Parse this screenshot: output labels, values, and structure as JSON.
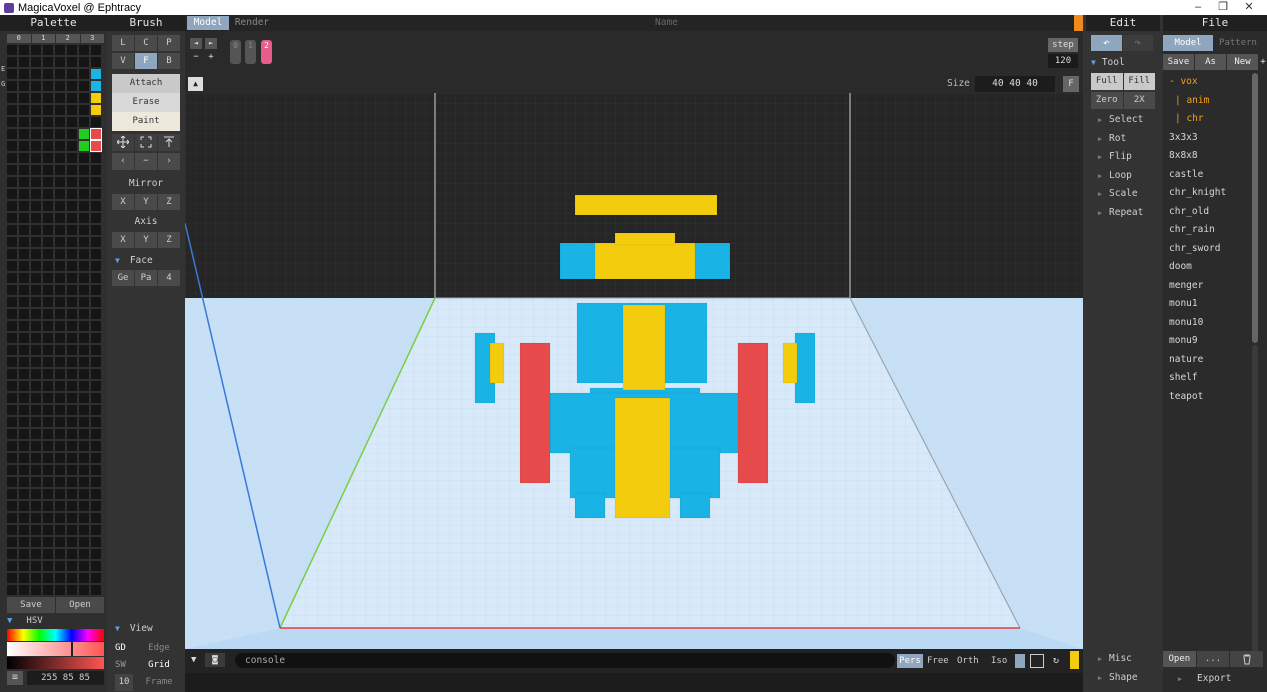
{
  "window": {
    "title": "MagicaVoxel @ Ephtracy",
    "minimize": "–",
    "restore": "❐",
    "close": "✕"
  },
  "palette": {
    "title": "Palette",
    "tabs": [
      "0",
      "1",
      "2",
      "3"
    ],
    "side_letters": [
      "E",
      "G"
    ],
    "save": "Save",
    "open": "Open",
    "hsv_label": "HSV",
    "rgb_value": "255 85 85",
    "menu_glyph": "≡",
    "swatches": {
      "cyan": "#1ab3e6",
      "yellow": "#f2cc0d",
      "green": "#22cc22",
      "red": "#e64a4a"
    }
  },
  "brush": {
    "title": "Brush",
    "row1": [
      "L",
      "C",
      "P"
    ],
    "row2": [
      "V",
      "F",
      "B"
    ],
    "modes": [
      "Attach",
      "Erase",
      "Paint"
    ],
    "nav": [
      "‹",
      "−",
      "›"
    ],
    "mirror": "Mirror",
    "mirror_axes": [
      "X",
      "Y",
      "Z"
    ],
    "axis": "Axis",
    "axis_axes": [
      "X",
      "Y",
      "Z"
    ],
    "face": "Face",
    "face_btns": [
      "Ge",
      "Pa",
      "4"
    ],
    "view": "View",
    "view_rows": [
      [
        "GD",
        "Edge"
      ],
      [
        "SW",
        "Grid"
      ],
      [
        "10",
        "Frame"
      ]
    ]
  },
  "top": {
    "tabs": [
      "Model",
      "Render"
    ],
    "name": "Name",
    "step": "step",
    "step_value": "120",
    "size_label": "Size",
    "size_value": "40 40 40",
    "f": "F",
    "frames": [
      "0",
      "1",
      "2"
    ],
    "left_arrow": "◄",
    "right_arrow": "►",
    "minus": "−",
    "plus": "+"
  },
  "bottom": {
    "console": "console",
    "proj": [
      "Pers",
      "Free",
      "Orth",
      "Iso"
    ]
  },
  "edit": {
    "title": "Edit",
    "undo": "↶",
    "redo": "↷",
    "tool": "Tool",
    "grid_btns": [
      [
        "Full",
        "Fill"
      ],
      [
        "Zero",
        "2X"
      ]
    ],
    "items": [
      "Select",
      "Rot",
      "Flip",
      "Loop",
      "Scale",
      "Repeat"
    ],
    "misc": "Misc",
    "shape": "Shape"
  },
  "file": {
    "title": "File",
    "tabs": [
      "Model",
      "Pattern"
    ],
    "actions": [
      "Save",
      "As",
      "New",
      "+"
    ],
    "tree": [
      "- vox",
      "| anim",
      "| chr"
    ],
    "files": [
      "3x3x3",
      "8x8x8",
      "castle",
      "chr_knight",
      "chr_old",
      "chr_rain",
      "chr_sword",
      "doom",
      "menger",
      "monu1",
      "monu10",
      "monu9",
      "nature",
      "shelf",
      "teapot"
    ],
    "open": "Open",
    "more": "...",
    "trash": "🗑",
    "export": "Export"
  }
}
